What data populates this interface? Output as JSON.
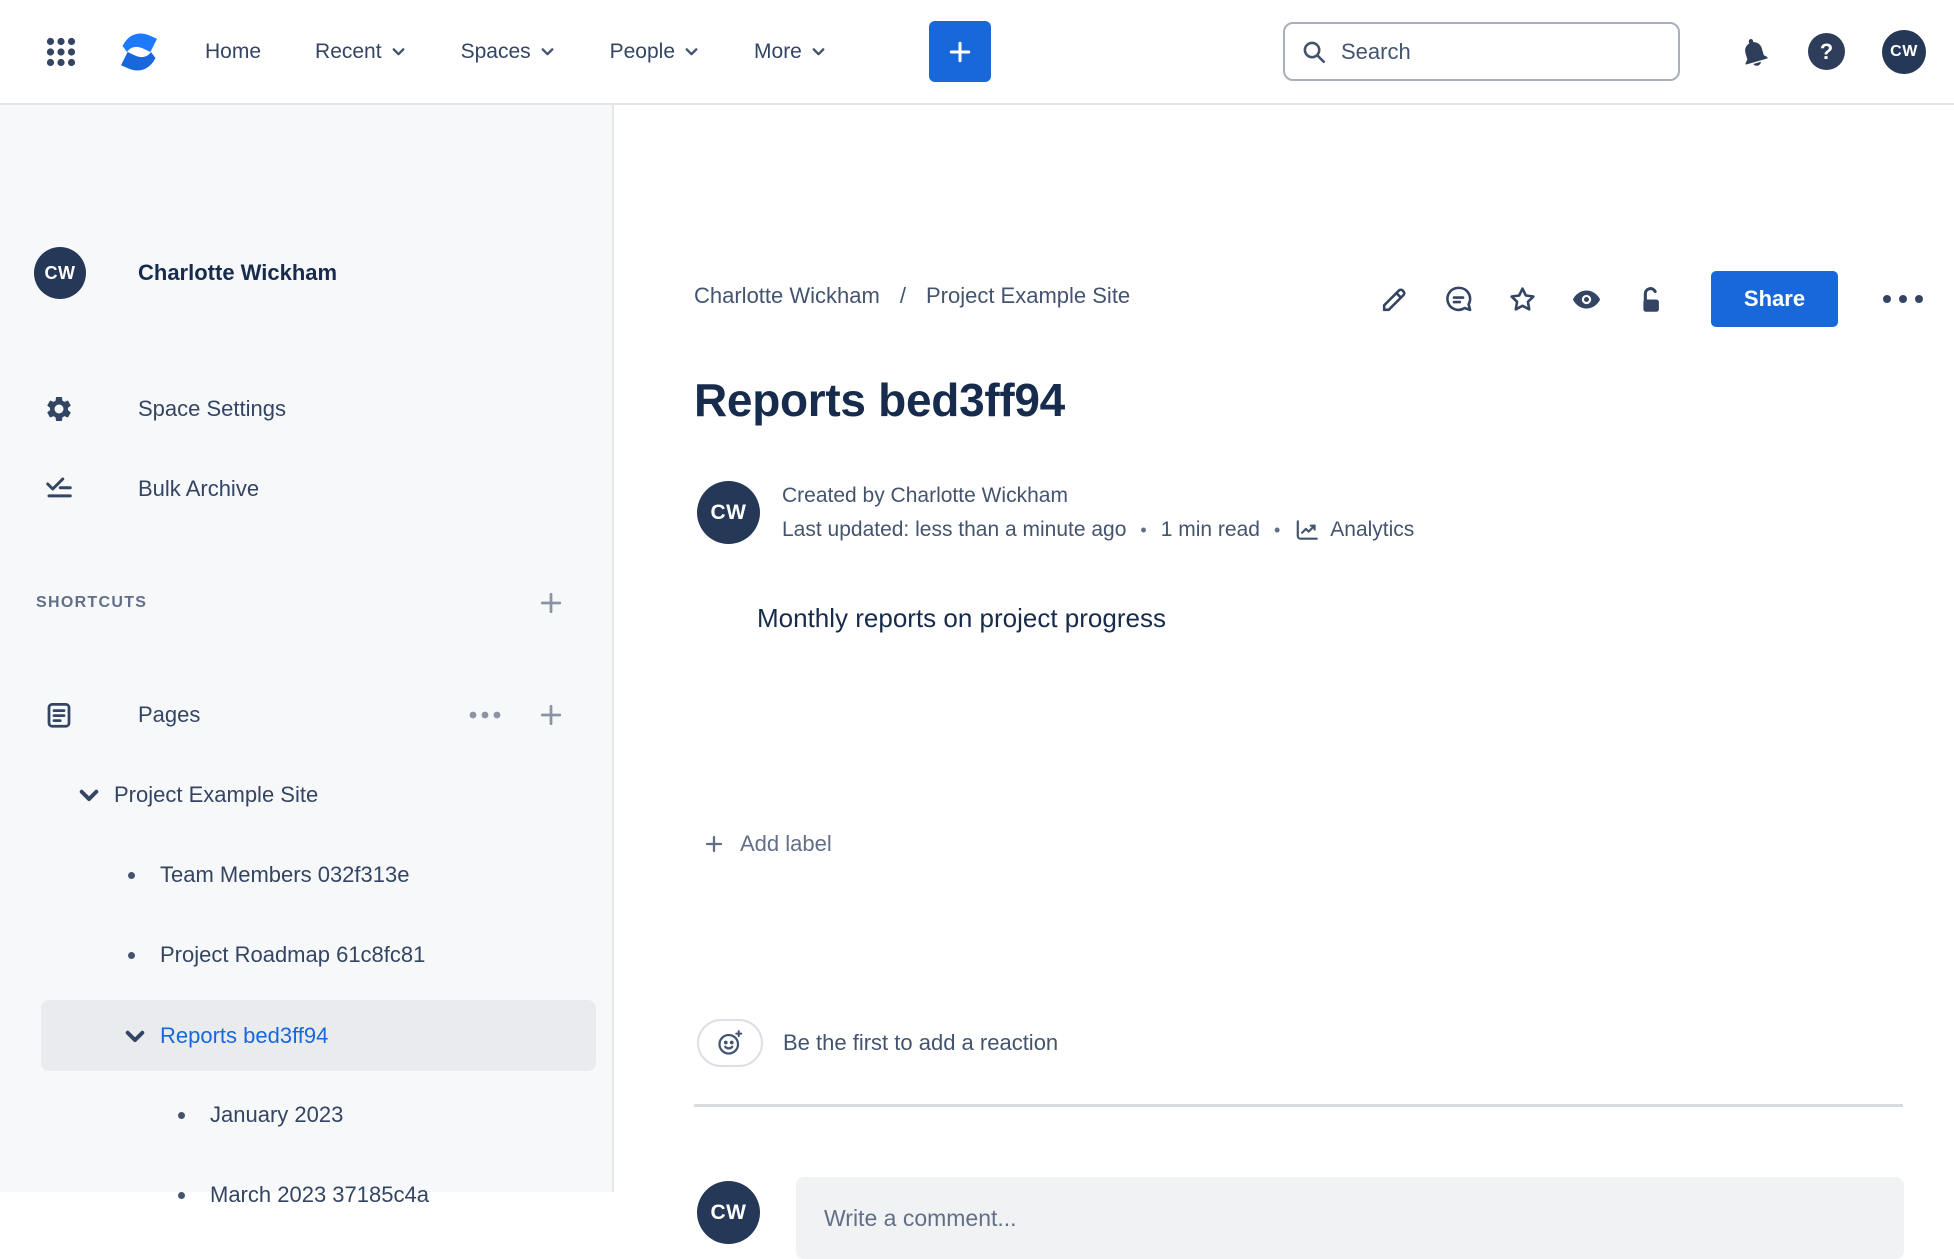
{
  "navbar": {
    "menu": {
      "home": "Home",
      "recent": "Recent",
      "spaces": "Spaces",
      "people": "People",
      "more": "More"
    },
    "search_placeholder": "Search",
    "avatar_initials": "CW"
  },
  "sidebar": {
    "avatar_initials": "CW",
    "space_name": "Charlotte Wickham",
    "space_settings_label": "Space Settings",
    "bulk_archive_label": "Bulk Archive",
    "shortcuts_label": "SHORTCUTS",
    "pages_label": "Pages",
    "tree": [
      {
        "label": "Project Example Site",
        "type": "expanded",
        "level": 0
      },
      {
        "label": "Team Members 032f313e",
        "type": "leaf",
        "level": 1
      },
      {
        "label": "Project Roadmap 61c8fc81",
        "type": "leaf",
        "level": 1
      },
      {
        "label": "Reports bed3ff94",
        "type": "expanded",
        "level": 1,
        "selected": true
      },
      {
        "label": "January 2023",
        "type": "leaf",
        "level": 2
      },
      {
        "label": "March 2023 37185c4a",
        "type": "leaf",
        "level": 2
      }
    ]
  },
  "content": {
    "breadcrumb": {
      "space": "Charlotte Wickham",
      "separator": "/",
      "parent": "Project Example Site"
    },
    "share_label": "Share",
    "title": "Reports bed3ff94",
    "byline": {
      "avatar_initials": "CW",
      "created": "Created by Charlotte Wickham",
      "updated": "Last updated: less than a minute ago",
      "dot": "•",
      "read_time": "1 min read",
      "analytics_label": "Analytics"
    },
    "body_text": "Monthly reports on project progress",
    "add_label_text": "Add label",
    "reaction_prompt": "Be the first to add a reaction",
    "comment_placeholder": "Write a comment..."
  },
  "colors": {
    "accent_blue": "#1868DB",
    "navy_text": "#172B4D",
    "secondary_text": "#44546F",
    "avatar_navy": "#253858",
    "sidebar_bg": "#F7F8F9"
  }
}
